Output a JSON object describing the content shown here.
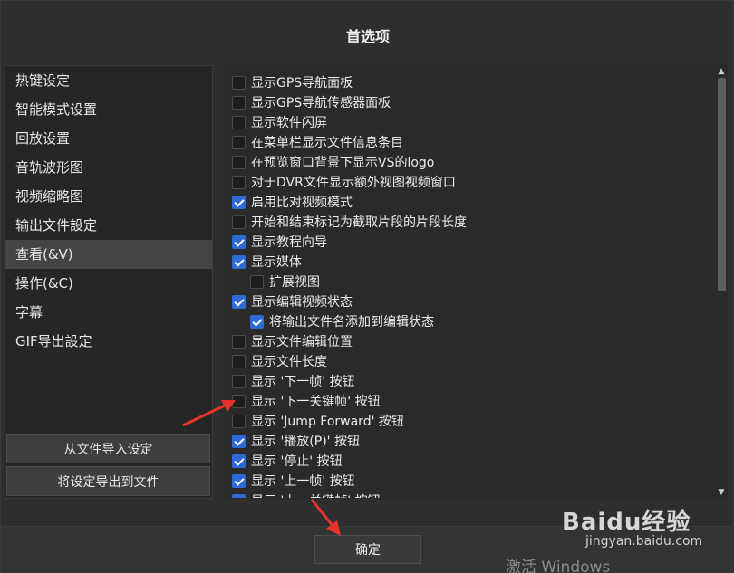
{
  "window": {
    "title": "首选项"
  },
  "sidebar": {
    "items": [
      {
        "label": "热键设定",
        "active": false
      },
      {
        "label": "智能模式设置",
        "active": false
      },
      {
        "label": "回放设置",
        "active": false
      },
      {
        "label": "音轨波形图",
        "active": false
      },
      {
        "label": "视频缩略图",
        "active": false
      },
      {
        "label": "输出文件設定",
        "active": false
      },
      {
        "label": "查看(&V)",
        "active": true
      },
      {
        "label": "操作(&C)",
        "active": false
      },
      {
        "label": "字幕",
        "active": false
      },
      {
        "label": "GIF导出設定",
        "active": false
      }
    ],
    "import_label": "从文件导入设定",
    "export_label": "将设定导出到文件"
  },
  "options": [
    {
      "label": "显示GPS导航面板",
      "checked": false,
      "indent": false
    },
    {
      "label": "显示GPS导航传感器面板",
      "checked": false,
      "indent": false
    },
    {
      "label": "显示软件闪屏",
      "checked": false,
      "indent": false
    },
    {
      "label": "在菜单栏显示文件信息条目",
      "checked": false,
      "indent": false
    },
    {
      "label": "在预览窗口背景下显示VS的logo",
      "checked": false,
      "indent": false
    },
    {
      "label": "对于DVR文件显示额外视图视频窗口",
      "checked": false,
      "indent": false
    },
    {
      "label": "启用比对视频模式",
      "checked": true,
      "indent": false
    },
    {
      "label": "开始和结束标记为截取片段的片段长度",
      "checked": false,
      "indent": false
    },
    {
      "label": "显示教程向导",
      "checked": true,
      "indent": false
    },
    {
      "label": "显示媒体",
      "checked": true,
      "indent": false
    },
    {
      "label": "扩展视图",
      "checked": false,
      "indent": true
    },
    {
      "label": "显示编辑视频状态",
      "checked": true,
      "indent": false
    },
    {
      "label": "将输出文件名添加到编辑状态",
      "checked": true,
      "indent": true
    },
    {
      "label": "显示文件编辑位置",
      "checked": false,
      "indent": false
    },
    {
      "label": "显示文件长度",
      "checked": false,
      "indent": false
    },
    {
      "label": "显示 '下一帧' 按钮",
      "checked": false,
      "indent": false
    },
    {
      "label": "显示 '下一关键帧' 按钮",
      "checked": false,
      "indent": false
    },
    {
      "label": "显示 'Jump Forward' 按钮",
      "checked": false,
      "indent": false
    },
    {
      "label": "显示 '播放(P)' 按钮",
      "checked": true,
      "indent": false
    },
    {
      "label": "显示 '停止' 按钮",
      "checked": true,
      "indent": false
    },
    {
      "label": "显示 '上一帧' 按钮",
      "checked": true,
      "indent": false
    },
    {
      "label": "显示 '上一关键帧' 按钮",
      "checked": true,
      "indent": false
    }
  ],
  "footer": {
    "ok_label": "确定"
  },
  "overlay": {
    "watermark_logo": "Baidu经验",
    "watermark_url": "jingyan.baidu.com",
    "activate_text": "激活 Windows"
  },
  "colors": {
    "accent": "#2d6ad6",
    "annotation_arrow": "#e8322c"
  }
}
